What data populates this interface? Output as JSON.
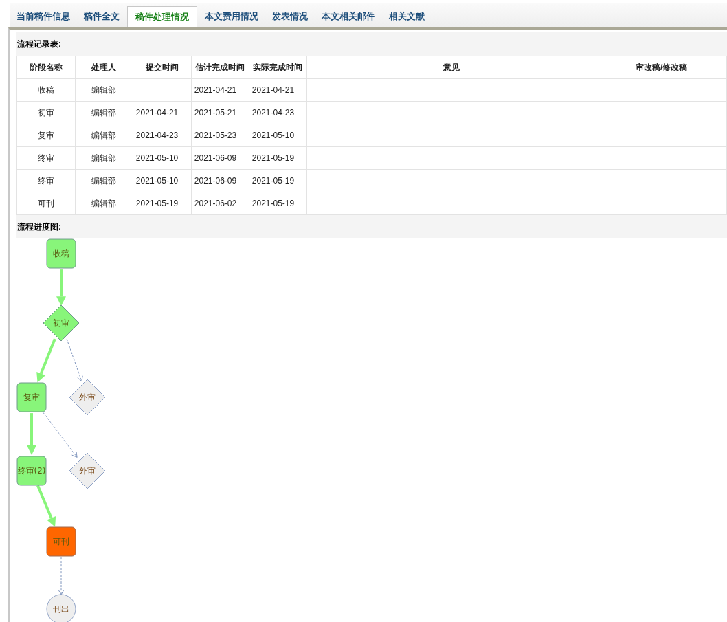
{
  "tabs": [
    {
      "label": "当前稿件信息",
      "selected": false
    },
    {
      "label": "稿件全文",
      "selected": false
    },
    {
      "label": "稿件处理情况",
      "selected": true
    },
    {
      "label": "本文费用情况",
      "selected": false
    },
    {
      "label": "发表情况",
      "selected": false
    },
    {
      "label": "本文相关邮件",
      "selected": false
    },
    {
      "label": "相关文献",
      "selected": false
    }
  ],
  "record_section": {
    "title": "流程记录表:"
  },
  "table": {
    "columns": [
      "阶段名称",
      "处理人",
      "提交时间",
      "估计完成时间",
      "实际完成时间",
      "意见",
      "审改稿/修改稿"
    ],
    "rows": [
      {
        "stage": "收稿",
        "handler": "编辑部",
        "estimated": "2021-04-21",
        "actual": "2021-04-21"
      },
      {
        "stage": "初审",
        "handler": "编辑部",
        "submitted": "2021-04-21",
        "estimated": "2021-05-21",
        "actual": "2021-04-23"
      },
      {
        "stage": "复审",
        "handler": "编辑部",
        "submitted": "2021-04-23",
        "estimated": "2021-05-23",
        "actual": "2021-05-10"
      },
      {
        "stage": "终审",
        "handler": "编辑部",
        "submitted": "2021-05-10",
        "estimated": "2021-06-09",
        "actual": "2021-05-19"
      },
      {
        "stage": "终审",
        "handler": "编辑部",
        "submitted": "2021-05-10",
        "estimated": "2021-06-09",
        "actual": "2021-05-19"
      },
      {
        "stage": "可刊",
        "handler": "编辑部",
        "submitted": "2021-05-19",
        "estimated": "2021-06-02",
        "actual": "2021-05-19"
      }
    ]
  },
  "progress_section": {
    "title": "流程进度图:"
  },
  "flowchart": {
    "nodes": [
      {
        "label": "收稿",
        "kind": "box",
        "color": "#88f57a"
      },
      {
        "label": "初审",
        "kind": "diamond",
        "color": "#88f57a"
      },
      {
        "label": "复审",
        "kind": "box",
        "color": "#88f57a"
      },
      {
        "label": "外审",
        "kind": "diamond",
        "color": "#eeeeee"
      },
      {
        "label": "终审(2)",
        "kind": "box",
        "color": "#88f57a"
      },
      {
        "label": "外审",
        "kind": "diamond",
        "color": "#eeeeee"
      },
      {
        "label": "可刊",
        "kind": "box",
        "color": "#ff6600"
      },
      {
        "label": "刊出",
        "kind": "circle",
        "color": "#eeeeee"
      }
    ],
    "edges": [
      {
        "kind": "done"
      },
      {
        "kind": "done"
      },
      {
        "kind": "pending"
      },
      {
        "kind": "done"
      },
      {
        "kind": "pending"
      },
      {
        "kind": "done"
      },
      {
        "kind": "pending"
      }
    ]
  }
}
